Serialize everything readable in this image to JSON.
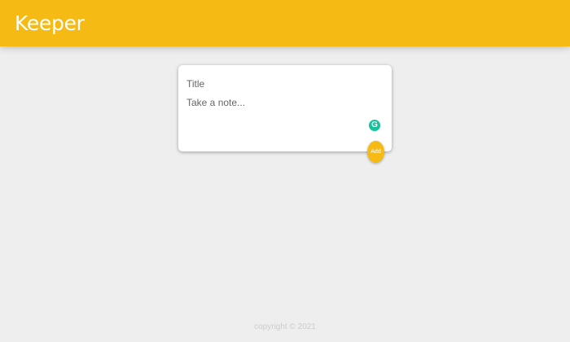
{
  "header": {
    "brand": "Keeper"
  },
  "form": {
    "title_placeholder": "Title",
    "content_placeholder": "Take a note...",
    "add_label": "Add",
    "grammarly_glyph": "G"
  },
  "footer": {
    "text": "copyright © 2021"
  },
  "colors": {
    "accent": "#f5ba13",
    "background": "#eeeeee",
    "grammarly": "#15c39a"
  }
}
